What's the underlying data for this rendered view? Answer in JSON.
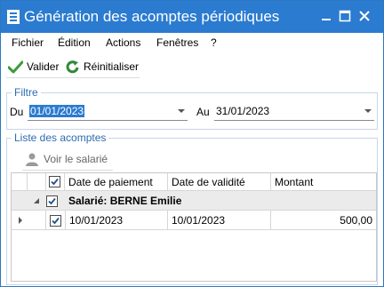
{
  "window": {
    "title": "Génération des acomptes périodiques",
    "accent": "#2b7bd0"
  },
  "menu": [
    "Fichier",
    "Édition",
    "Actions",
    "Fenêtres",
    "?"
  ],
  "toolbar": {
    "validate_label": "Valider",
    "validate_icon": "checkmark-icon",
    "reset_label": "Réinitialiser",
    "reset_icon": "refresh-icon"
  },
  "filter": {
    "group_title": "Filtre",
    "from_label": "Du",
    "from_value": "01/01/2023",
    "to_label": "Au",
    "to_value": "31/01/2023"
  },
  "list": {
    "group_title": "Liste des acomptes",
    "view_employee_label": "Voir le salarié",
    "columns": [
      "Date de paiement",
      "Date de validité",
      "Montant"
    ],
    "group_row": "Salarié: BERNE Emilie",
    "rows": [
      {
        "payment_date": "10/01/2023",
        "validity_date": "10/01/2023",
        "amount": "500,00",
        "checked": true
      }
    ]
  }
}
